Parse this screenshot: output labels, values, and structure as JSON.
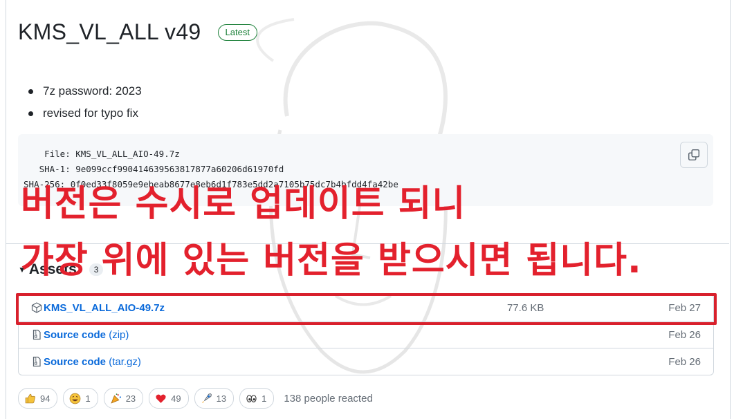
{
  "release": {
    "title": "KMS_VL_ALL v49",
    "badge": "Latest"
  },
  "notes": {
    "bullets": [
      "7z password: 2023",
      "revised for typo fix"
    ]
  },
  "checksums": {
    "file_line": "    File: KMS_VL_ALL_AIO-49.7z",
    "sha1_line": "   SHA-1: 9e099ccf990414639563817877a60206d61970fd",
    "sha256_line": "SHA-256: 0f0ed33f8059e9ebeab8677e8eb6d1f783e5dd2a7105b75dc7b4bfdd4fa42be"
  },
  "assets": {
    "label": "Assets",
    "count": "3",
    "items": [
      {
        "name": "KMS_VL_ALL_AIO-49.7z",
        "sub": "",
        "size": "77.6 KB",
        "date": "Feb 27"
      },
      {
        "name": "Source code",
        "sub": "(zip)",
        "size": "",
        "date": "Feb 26"
      },
      {
        "name": "Source code",
        "sub": "(tar.gz)",
        "size": "",
        "date": "Feb 26"
      }
    ]
  },
  "overlay": {
    "line1": "버전은 수시로 업데이트 되니",
    "line2": "가장 위에 있는 버전을 받으시면 됩니다."
  },
  "reactions": {
    "items": [
      {
        "icon": "thumbs-up-icon",
        "count": "94"
      },
      {
        "icon": "laugh-icon",
        "count": "1"
      },
      {
        "icon": "hooray-icon",
        "count": "23"
      },
      {
        "icon": "heart-icon",
        "count": "49"
      },
      {
        "icon": "rocket-icon",
        "count": "13"
      },
      {
        "icon": "eyes-icon",
        "count": "1"
      }
    ],
    "summary": "138 people reacted"
  },
  "colors": {
    "accent": "#0969da",
    "overlay_red": "#e3212d",
    "latest_green": "#1a7f37"
  }
}
